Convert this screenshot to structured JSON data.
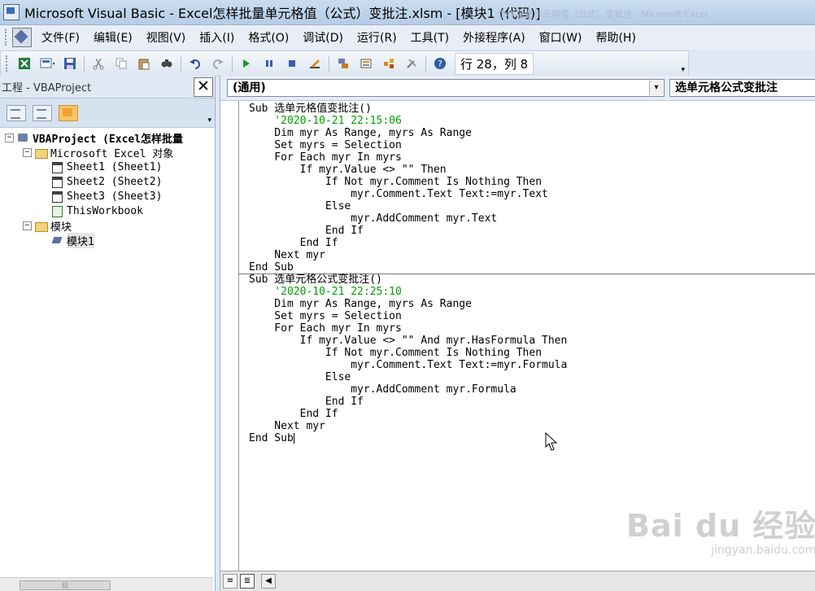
{
  "window": {
    "title": "Microsoft Visual Basic - Excel怎样批量单元格值（公式）变批注.xlsm - [模块1 (代码)]",
    "ghost_title": "怎样批量单元格值（公式）变批注 - Microsoft Excel"
  },
  "menubar": {
    "items": [
      "文件(F)",
      "编辑(E)",
      "视图(V)",
      "插入(I)",
      "格式(O)",
      "调试(D)",
      "运行(R)",
      "工具(T)",
      "外接程序(A)",
      "窗口(W)",
      "帮助(H)"
    ]
  },
  "toolbar": {
    "icons": [
      "excel-view-icon",
      "insert-module-icon",
      "save-icon",
      "cut-icon",
      "copy-icon",
      "paste-icon",
      "find-icon",
      "undo-icon",
      "redo-icon",
      "run-icon",
      "break-icon",
      "reset-icon",
      "design-mode-icon",
      "project-explorer-icon",
      "properties-icon",
      "object-browser-icon",
      "toolbox-icon",
      "help-icon"
    ],
    "status": "行 28，列 8",
    "overflow_label": "▾"
  },
  "project_panel": {
    "title": "工程 - VBAProject",
    "close_label": "✕",
    "tree": [
      {
        "label": "VBAProject (Excel怎样批量",
        "indent": 0,
        "expander": "−",
        "icon": "project",
        "bold": true
      },
      {
        "label": "Microsoft Excel 对象",
        "indent": 1,
        "expander": "−",
        "icon": "folder"
      },
      {
        "label": "Sheet1 (Sheet1)",
        "indent": 2,
        "expander": "",
        "icon": "sheet"
      },
      {
        "label": "Sheet2 (Sheet2)",
        "indent": 2,
        "expander": "",
        "icon": "sheet"
      },
      {
        "label": "Sheet3 (Sheet3)",
        "indent": 2,
        "expander": "",
        "icon": "sheet"
      },
      {
        "label": "ThisWorkbook",
        "indent": 2,
        "expander": "",
        "icon": "wb"
      },
      {
        "label": "模块",
        "indent": 1,
        "expander": "−",
        "icon": "folder"
      },
      {
        "label": "模块1",
        "indent": 2,
        "expander": "",
        "icon": "module",
        "selected": true
      }
    ],
    "scroll_thumb_label": "|||"
  },
  "code_window": {
    "object_combo": "(通用)",
    "procedure_combo": "选单元格公式变批注",
    "lines": [
      {
        "text": "Sub 选单元格值变批注()",
        "type": "code"
      },
      {
        "text": "    '2020-10-21 22:15:06",
        "type": "comment"
      },
      {
        "text": "    Dim myr As Range, myrs As Range",
        "type": "code"
      },
      {
        "text": "    Set myrs = Selection",
        "type": "code"
      },
      {
        "text": "    For Each myr In myrs",
        "type": "code"
      },
      {
        "text": "        If myr.Value <> \"\" Then",
        "type": "code"
      },
      {
        "text": "            If Not myr.Comment Is Nothing Then",
        "type": "code"
      },
      {
        "text": "                myr.Comment.Text Text:=myr.Text",
        "type": "code"
      },
      {
        "text": "            Else",
        "type": "code"
      },
      {
        "text": "                myr.AddComment myr.Text",
        "type": "code"
      },
      {
        "text": "            End If",
        "type": "code"
      },
      {
        "text": "        End If",
        "type": "code"
      },
      {
        "text": "    Next myr",
        "type": "code"
      },
      {
        "text": "End Sub",
        "type": "code",
        "separator": true
      },
      {
        "text": "Sub 选单元格公式变批注()",
        "type": "code"
      },
      {
        "text": "    '2020-10-21 22:25:10",
        "type": "comment"
      },
      {
        "text": "    Dim myr As Range, myrs As Range",
        "type": "code"
      },
      {
        "text": "    Set myrs = Selection",
        "type": "code"
      },
      {
        "text": "    For Each myr In myrs",
        "type": "code"
      },
      {
        "text": "        If myr.Value <> \"\" And myr.HasFormula Then",
        "type": "code"
      },
      {
        "text": "            If Not myr.Comment Is Nothing Then",
        "type": "code"
      },
      {
        "text": "                myr.Comment.Text Text:=myr.Formula",
        "type": "code"
      },
      {
        "text": "            Else",
        "type": "code"
      },
      {
        "text": "                myr.AddComment myr.Formula",
        "type": "code"
      },
      {
        "text": "            End If",
        "type": "code"
      },
      {
        "text": "        End If",
        "type": "code"
      },
      {
        "text": "    Next myr",
        "type": "code"
      },
      {
        "text": "End Sub",
        "type": "code",
        "caret": true
      }
    ]
  },
  "watermark": {
    "main": "Bai du 经验",
    "sub": "jingyan.baidu.com"
  }
}
